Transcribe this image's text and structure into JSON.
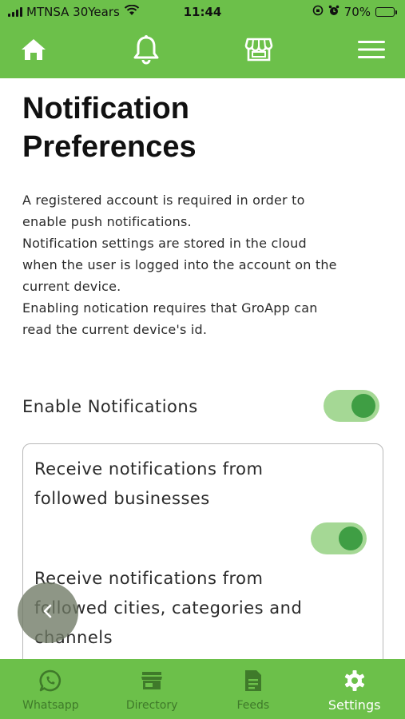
{
  "status_bar": {
    "carrier": "MTNSA 30Years",
    "time": "11:44",
    "battery_percent": "70%",
    "battery_level": 0.7,
    "icons": [
      "signal-icon",
      "wifi-icon",
      "rotation-lock-icon",
      "alarm-icon",
      "battery-icon"
    ]
  },
  "top_nav": {
    "icons": [
      "home-icon",
      "bell-icon",
      "store-icon",
      "menu-icon"
    ]
  },
  "page": {
    "title_line1": "Notification",
    "title_line2": "Preferences",
    "description_lines": [
      "A registered account is required in order to",
      "enable push notifications.",
      "Notification settings are stored in the cloud",
      "when the user is logged into the account on the",
      "current device.",
      "Enabling notication requires that GroApp can",
      "read the current device's id."
    ]
  },
  "enable_notifications": {
    "label": "Enable Notifications",
    "on": true
  },
  "options": [
    {
      "label_line1": "Receive notifications from",
      "label_line2": "followed businesses",
      "on": true
    },
    {
      "label_line1": "Receive notifications from",
      "label_line2": "followed cities, categories and",
      "label_line3": "channels"
    }
  ],
  "bottom_nav": {
    "items": [
      {
        "label": "Whatsapp",
        "icon": "whatsapp-icon"
      },
      {
        "label": "Directory",
        "icon": "directory-icon"
      },
      {
        "label": "Feeds",
        "icon": "feeds-icon"
      },
      {
        "label": "Settings",
        "icon": "gear-icon",
        "active": true
      }
    ]
  },
  "colors": {
    "brand_green": "#6cc04a",
    "toggle_track": "#a5d895",
    "toggle_knob": "#3f9e44",
    "inactive_nav": "#3f7a2a",
    "active_nav": "#ffffff"
  }
}
